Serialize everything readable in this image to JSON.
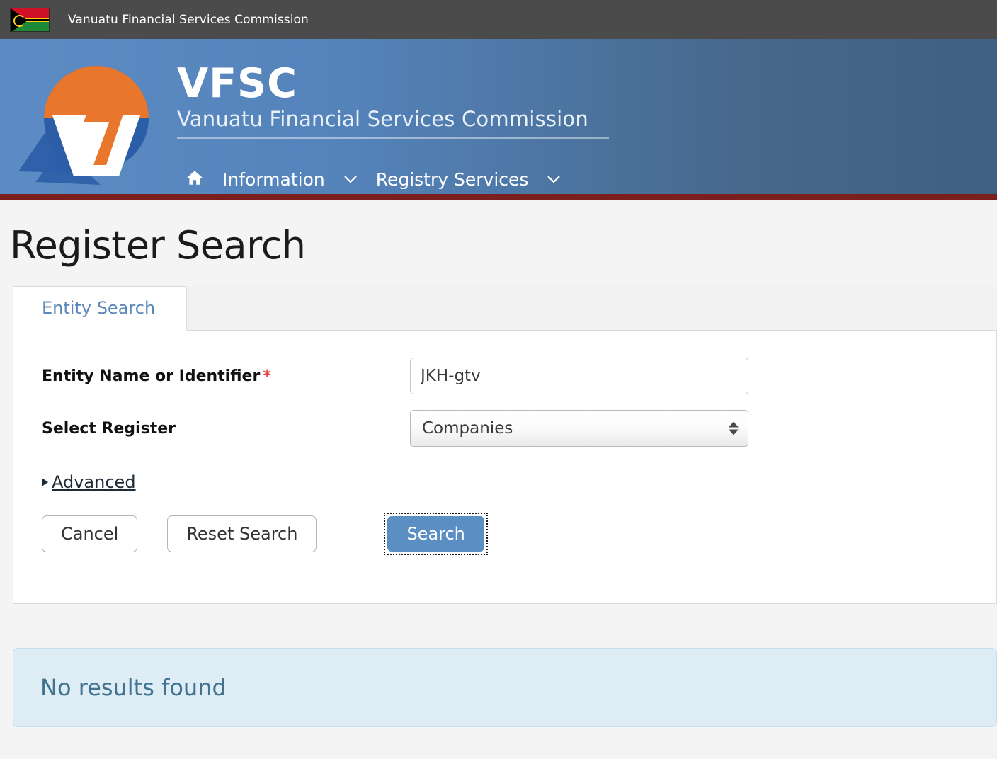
{
  "gov_bar": {
    "flag_icon": "vanuatu-flag-icon",
    "title": "Vanuatu Financial Services Commission"
  },
  "banner": {
    "logo_icon": "vfsc-logo-icon",
    "brand_acronym": "VFSC",
    "brand_name": "Vanuatu Financial Services Commission",
    "nav": {
      "home_icon": "home-icon",
      "items": [
        {
          "label": "Information",
          "chevron_icon": "chevron-down-icon"
        },
        {
          "label": "Registry Services",
          "chevron_icon": "chevron-down-icon"
        }
      ]
    }
  },
  "page": {
    "title": "Register Search"
  },
  "tabs": [
    {
      "label": "Entity Search",
      "active": true
    }
  ],
  "form": {
    "entity_name": {
      "label": "Entity Name or Identifier",
      "required_marker": "*",
      "value": "JKH-gtv",
      "placeholder": ""
    },
    "select_register": {
      "label": "Select Register",
      "selected": "Companies",
      "options": [
        "Companies"
      ]
    },
    "advanced": {
      "label": "Advanced",
      "marker_icon": "triangle-right-icon"
    },
    "buttons": {
      "cancel": "Cancel",
      "reset": "Reset Search",
      "search": "Search"
    }
  },
  "results": {
    "message": "No results found"
  },
  "colors": {
    "gov_bar_bg": "#4b4b4b",
    "banner_left": "#5d8cc4",
    "banner_right": "#3f6080",
    "banner_rule": "#7a1e1e",
    "tab_text": "#5a87b8",
    "required_asterisk": "#e8453c",
    "primary_button": "#5b8fc4",
    "info_box_bg": "#ddecf5",
    "info_box_text": "#41738f",
    "logo_orange": "#e8762c",
    "logo_blue": "#2c5ea8"
  }
}
